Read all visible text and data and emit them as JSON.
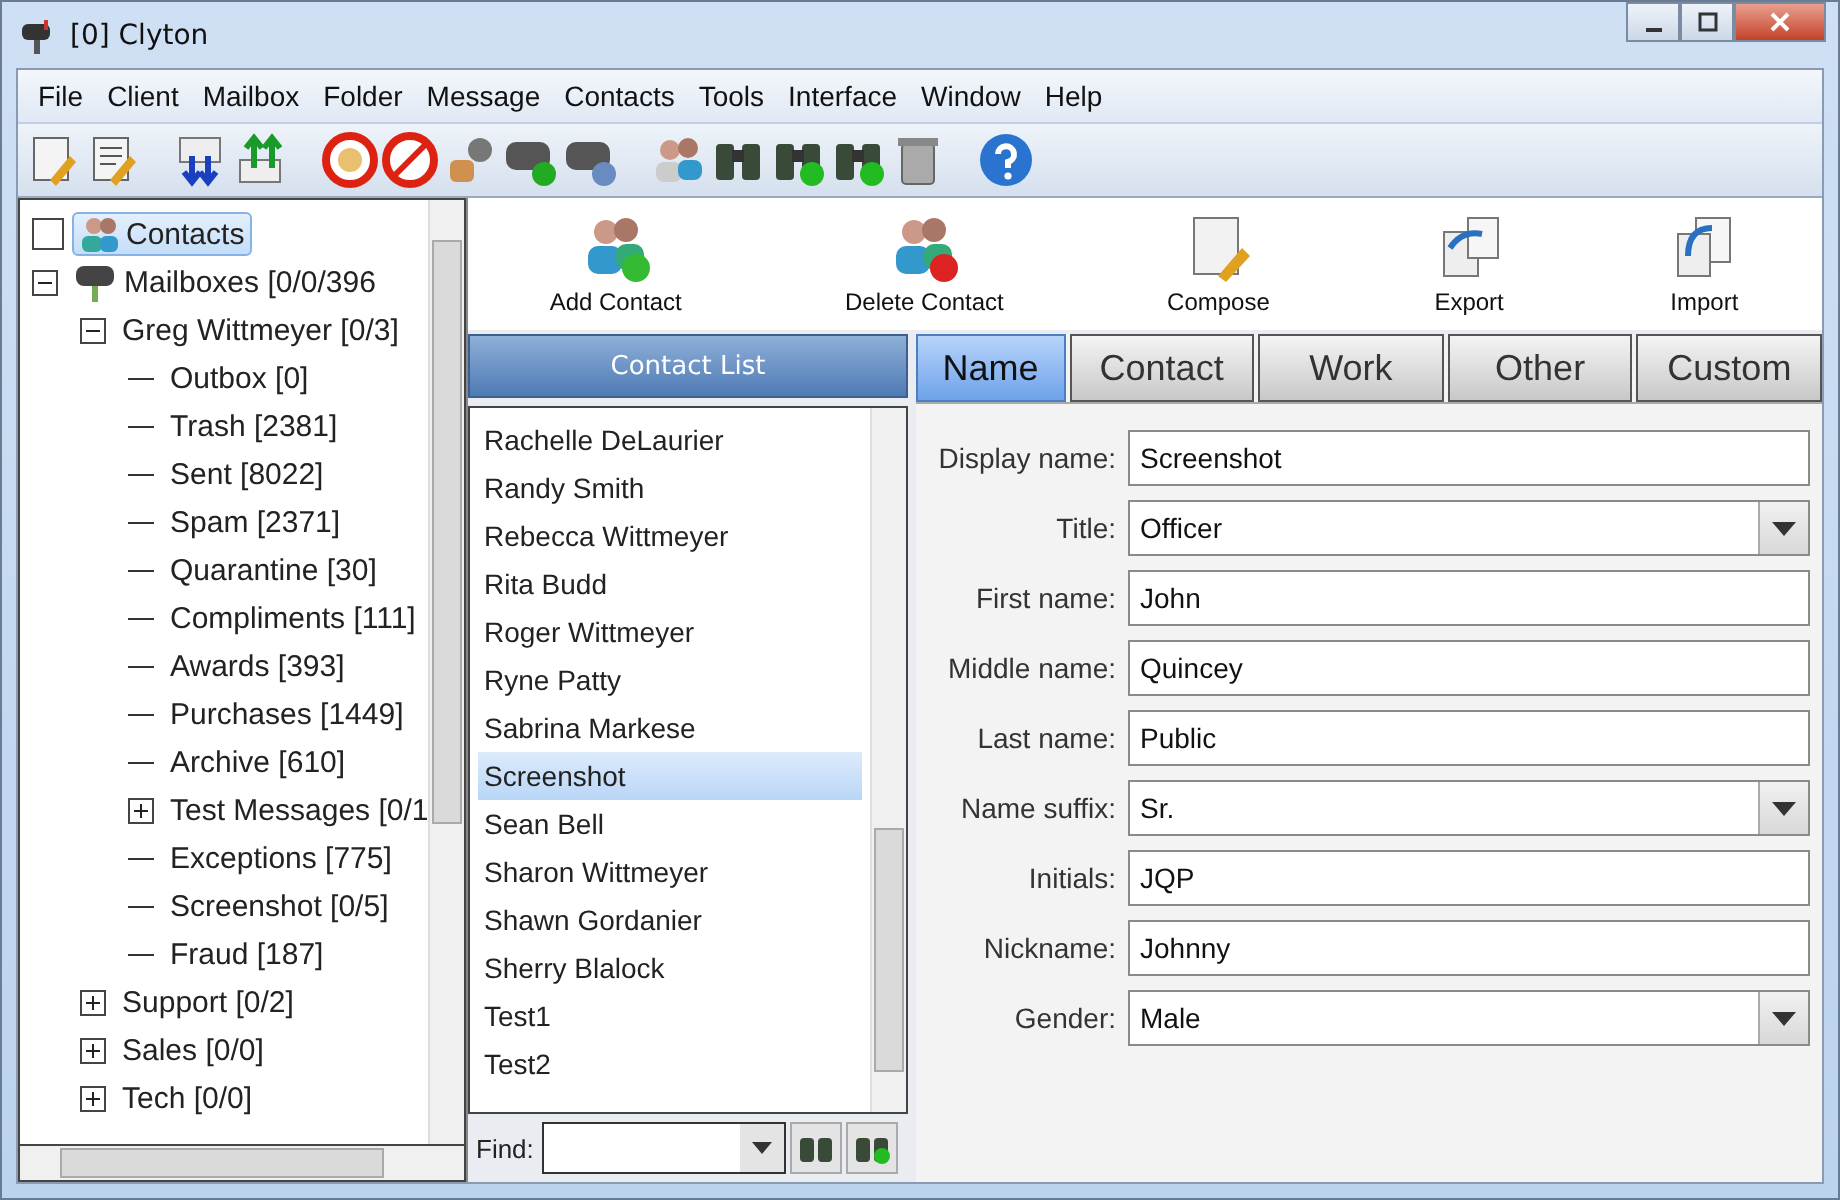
{
  "window": {
    "title": "[0] Clyton"
  },
  "menu": [
    "File",
    "Client",
    "Mailbox",
    "Folder",
    "Message",
    "Contacts",
    "Tools",
    "Interface",
    "Window",
    "Help"
  ],
  "tree": [
    {
      "label": "Contacts",
      "kind": "contacts",
      "selected": true,
      "checked": false
    },
    {
      "label": "Mailboxes [0/0/396",
      "kind": "mailboxes",
      "expanded": true,
      "selected": false,
      "children": [
        {
          "label": "Greg Wittmeyer [0/3]",
          "expanded": true,
          "selected": false,
          "children": [
            {
              "label": "Outbox [0]",
              "selected": false
            },
            {
              "label": "Trash [2381]",
              "selected": false
            },
            {
              "label": "Sent [8022]",
              "selected": false
            },
            {
              "label": "Spam [2371]",
              "selected": false
            },
            {
              "label": "Quarantine [30]",
              "selected": false
            },
            {
              "label": "Compliments [111]",
              "selected": false
            },
            {
              "label": "Awards [393]",
              "selected": false
            },
            {
              "label": "Purchases [1449]",
              "selected": false
            },
            {
              "label": "Archive [610]",
              "selected": false
            },
            {
              "label": "Test Messages [0/1",
              "expanded": false,
              "selected": false
            },
            {
              "label": "Exceptions [775]",
              "selected": false
            },
            {
              "label": "Screenshot [0/5]",
              "selected": false
            },
            {
              "label": "Fraud [187]",
              "selected": false
            }
          ]
        },
        {
          "label": "Support [0/2]",
          "expanded": false,
          "selected": false
        },
        {
          "label": "Sales [0/0]",
          "expanded": false,
          "selected": false
        },
        {
          "label": "Tech [0/0]",
          "expanded": false,
          "selected": false
        }
      ]
    }
  ],
  "actions": [
    {
      "label": "Add Contact",
      "kind": "add"
    },
    {
      "label": "Delete Contact",
      "kind": "delete"
    },
    {
      "label": "Compose",
      "kind": "compose"
    },
    {
      "label": "Export",
      "kind": "export"
    },
    {
      "label": "Import",
      "kind": "import"
    }
  ],
  "contact_list": {
    "title": "Contact List",
    "items": [
      {
        "name": "Rachelle DeLaurier",
        "selected": false
      },
      {
        "name": "Randy Smith",
        "selected": false
      },
      {
        "name": "Rebecca Wittmeyer",
        "selected": false
      },
      {
        "name": "Rita Budd",
        "selected": false
      },
      {
        "name": "Roger Wittmeyer",
        "selected": false
      },
      {
        "name": "Ryne Patty",
        "selected": false
      },
      {
        "name": "Sabrina Markese",
        "selected": false
      },
      {
        "name": "Screenshot",
        "selected": true
      },
      {
        "name": "Sean Bell",
        "selected": false
      },
      {
        "name": "Sharon Wittmeyer",
        "selected": false
      },
      {
        "name": "Shawn Gordanier",
        "selected": false
      },
      {
        "name": "Sherry Blalock",
        "selected": false
      },
      {
        "name": "Test1",
        "selected": false
      },
      {
        "name": "Test2",
        "selected": false
      }
    ],
    "find_label": "Find:"
  },
  "tabs": [
    {
      "label": "Name",
      "selected": true
    },
    {
      "label": "Contact",
      "selected": false
    },
    {
      "label": "Work",
      "selected": false
    },
    {
      "label": "Other",
      "selected": false
    },
    {
      "label": "Custom",
      "selected": false
    }
  ],
  "fields": [
    {
      "label": "Display name:",
      "value": "Screenshot",
      "kind": "text"
    },
    {
      "label": "Title:",
      "value": "Officer",
      "kind": "select"
    },
    {
      "label": "First name:",
      "value": "John",
      "kind": "text"
    },
    {
      "label": "Middle name:",
      "value": "Quincey",
      "kind": "text"
    },
    {
      "label": "Last name:",
      "value": "Public",
      "kind": "text"
    },
    {
      "label": "Name suffix:",
      "value": "Sr.",
      "kind": "select"
    },
    {
      "label": "Initials:",
      "value": "JQP",
      "kind": "text"
    },
    {
      "label": "Nickname:",
      "value": "Johnny",
      "kind": "text"
    },
    {
      "label": "Gender:",
      "value": "Male",
      "kind": "select"
    }
  ]
}
